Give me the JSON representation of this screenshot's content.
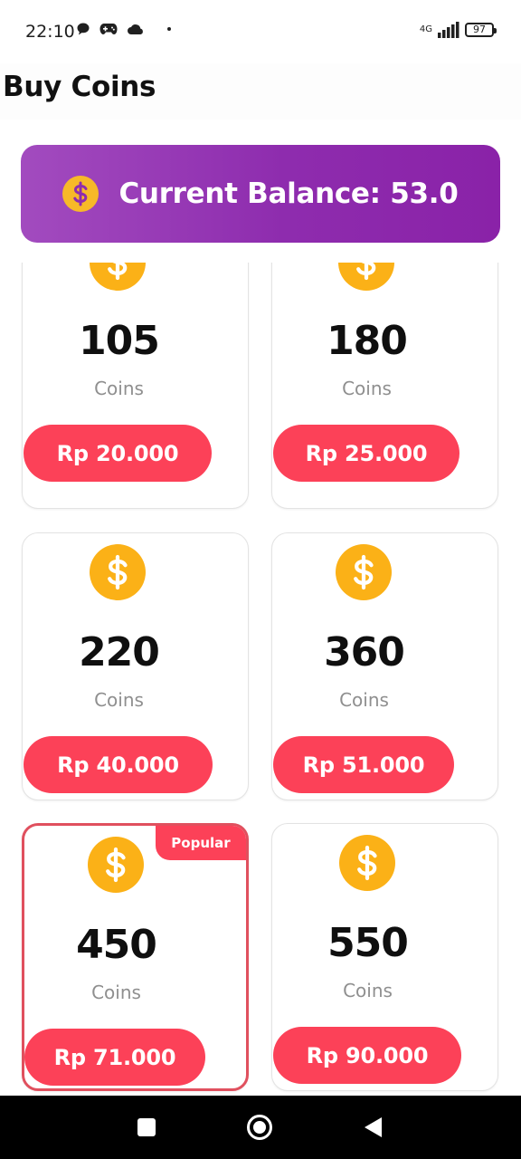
{
  "status_bar": {
    "time": "22:10",
    "network": "4G",
    "battery": "97",
    "icons": [
      "chat-icon",
      "gamepad-icon",
      "cloud-icon",
      "dot-icon"
    ]
  },
  "header": {
    "title": "Buy Coins"
  },
  "balance": {
    "label": "Current Balance: 53.0",
    "icon": "coin-icon"
  },
  "packages": [
    {
      "amount": "105",
      "unit": "Coins",
      "price": "Rp 20.000"
    },
    {
      "amount": "180",
      "unit": "Coins",
      "price": "Rp 25.000"
    },
    {
      "amount": "220",
      "unit": "Coins",
      "price": "Rp 40.000"
    },
    {
      "amount": "360",
      "unit": "Coins",
      "price": "Rp 51.000"
    },
    {
      "amount": "450",
      "unit": "Coins",
      "price": "Rp 71.000",
      "badge": "Popular"
    },
    {
      "amount": "550",
      "unit": "Coins",
      "price": "Rp 90.000"
    }
  ],
  "nav": {
    "icons": [
      "recents-icon",
      "home-icon",
      "back-icon"
    ]
  },
  "colors": {
    "balance_gradient_start": "#a24bbf",
    "balance_gradient_end": "#8a22a8",
    "accent_red": "#fc4158",
    "coin_gold": "#fbb117",
    "highlight_border": "#e0505e"
  }
}
